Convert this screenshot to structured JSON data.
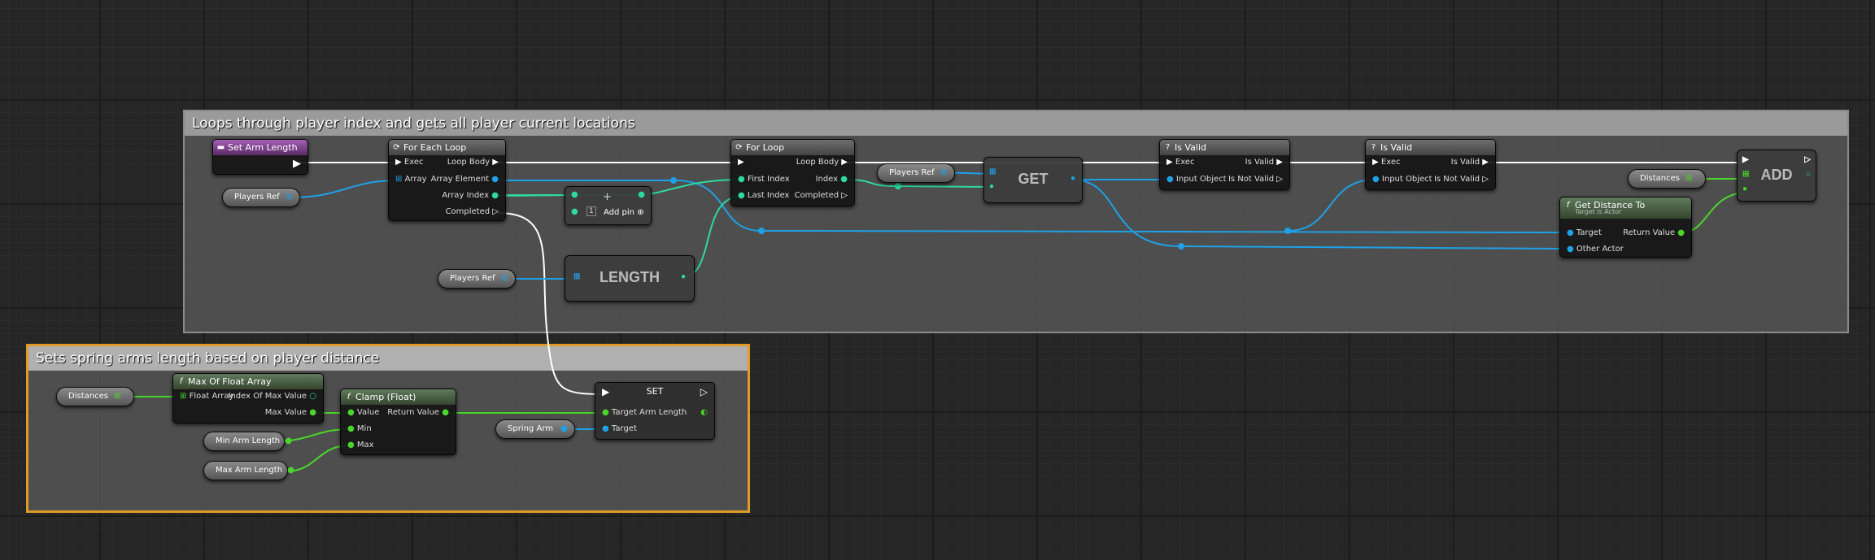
{
  "comments": {
    "top_title": "Loops through  player index and gets all player current locations",
    "bottom_title": "Sets spring arms length based on player distance"
  },
  "nodes": {
    "set_arm_length": {
      "title": "Set Arm Length"
    },
    "players_ref_1": {
      "label": "Players Ref"
    },
    "for_each": {
      "title": "For Each Loop",
      "exec": "Exec",
      "array": "Array",
      "loop_body": "Loop Body",
      "array_element": "Array Element",
      "array_index": "Array Index",
      "completed": "Completed"
    },
    "add_pin": {
      "label": "Add pin",
      "box": "1"
    },
    "players_ref_2": {
      "label": "Players Ref"
    },
    "length": {
      "label": "LENGTH"
    },
    "for_loop": {
      "title": "For Loop",
      "first_index": "First Index",
      "last_index": "Last Index",
      "loop_body": "Loop Body",
      "index": "Index",
      "completed": "Completed"
    },
    "players_ref_3": {
      "label": "Players Ref"
    },
    "get": {
      "label": "GET"
    },
    "is_valid_1": {
      "title": "Is Valid",
      "exec": "Exec",
      "input_object": "Input Object",
      "is_valid": "Is Valid",
      "is_not_valid": "Is Not Valid"
    },
    "is_valid_2": {
      "title": "Is Valid",
      "exec": "Exec",
      "input_object": "Input Object",
      "is_valid": "Is Valid",
      "is_not_valid": "Is Not Valid"
    },
    "get_distance": {
      "title": "Get Distance To",
      "subtitle": "Target is Actor",
      "target": "Target",
      "other_actor": "Other Actor",
      "return_value": "Return Value"
    },
    "distances_1": {
      "label": "Distances"
    },
    "add": {
      "label": "ADD"
    },
    "distances_2": {
      "label": "Distances"
    },
    "max_float": {
      "title": "Max Of Float Array",
      "float_array": "Float Array",
      "index_of_max": "Index Of Max Value",
      "max_value": "Max Value"
    },
    "min_arm": {
      "label": "Min Arm Length"
    },
    "max_arm": {
      "label": "Max Arm Length"
    },
    "clamp": {
      "title": "Clamp (Float)",
      "value": "Value",
      "min": "Min",
      "max": "Max",
      "return_value": "Return Value"
    },
    "spring_arm": {
      "label": "Spring Arm"
    },
    "set": {
      "title": "SET",
      "target_arm_length": "Target Arm Length",
      "target": "Target"
    }
  },
  "colors": {
    "exec": "#ffffff",
    "object": "#1ea1e6",
    "integer": "#2fd9a0",
    "float": "#4ad62a",
    "comment_border_selected": "#e09a2a"
  }
}
